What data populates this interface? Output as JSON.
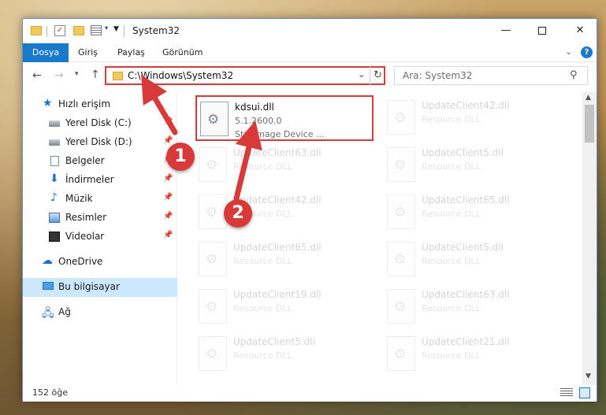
{
  "window": {
    "title": "System32",
    "min_glyph": "—",
    "close_glyph": "✕"
  },
  "ribbon": {
    "tabs": [
      "Dosya",
      "Giriş",
      "Paylaş",
      "Görünüm"
    ],
    "help": "?"
  },
  "address": {
    "path": "C:\\Windows\\System32",
    "search_placeholder": "Ara: System32"
  },
  "sidebar": {
    "items": [
      {
        "label": "Hızlı erişim",
        "icon": "star-icon"
      },
      {
        "label": "Yerel Disk (C:)",
        "icon": "disk-icon",
        "pinned": true
      },
      {
        "label": "Yerel Disk (D:)",
        "icon": "disk-icon",
        "pinned": true
      },
      {
        "label": "Belgeler",
        "icon": "documents-icon",
        "pinned": true
      },
      {
        "label": "İndirmeler",
        "icon": "download-icon",
        "pinned": true
      },
      {
        "label": "Müzik",
        "icon": "music-icon",
        "pinned": true
      },
      {
        "label": "Resimler",
        "icon": "pictures-icon",
        "pinned": true
      },
      {
        "label": "Videolar",
        "icon": "video-icon",
        "pinned": true
      },
      {
        "label": "OneDrive",
        "icon": "cloud-icon"
      },
      {
        "label": "Bu bilgisayar",
        "icon": "computer-icon",
        "selected": true
      },
      {
        "label": "Ağ",
        "icon": "network-icon"
      }
    ]
  },
  "files": [
    {
      "name": "kdsui.dll",
      "version": "5.1.2600.0",
      "description": "Still Image Device ...",
      "highlighted": true
    },
    {
      "name": "UpdateClient42.dll",
      "description": "Resource DLL"
    },
    {
      "name": "UpdateClient63.dll",
      "description": "Resource DLL"
    },
    {
      "name": "UpdateClient5.dll",
      "description": "Resource DLL"
    },
    {
      "name": "UpdateClient42.dll",
      "description": "Resource DLL"
    },
    {
      "name": "UpdateClient65.dll",
      "description": "Resource DLL"
    },
    {
      "name": "UpdateClient65.dll",
      "description": "Resource DLL"
    },
    {
      "name": "UpdateClient5.dll",
      "description": "Resource DLL"
    },
    {
      "name": "UpdateClient19.dll",
      "description": "Resource DLL"
    },
    {
      "name": "UpdateClient63.dll",
      "description": "Resource DLL"
    },
    {
      "name": "UpdateClient5.dll",
      "description": "Resource DLL"
    },
    {
      "name": "UpdateClient21.dll",
      "description": "Resource DLL"
    }
  ],
  "status": {
    "item_count": "152 öğe"
  },
  "annotations": {
    "step1": "1",
    "step2": "2",
    "color": "#d83a3a"
  }
}
